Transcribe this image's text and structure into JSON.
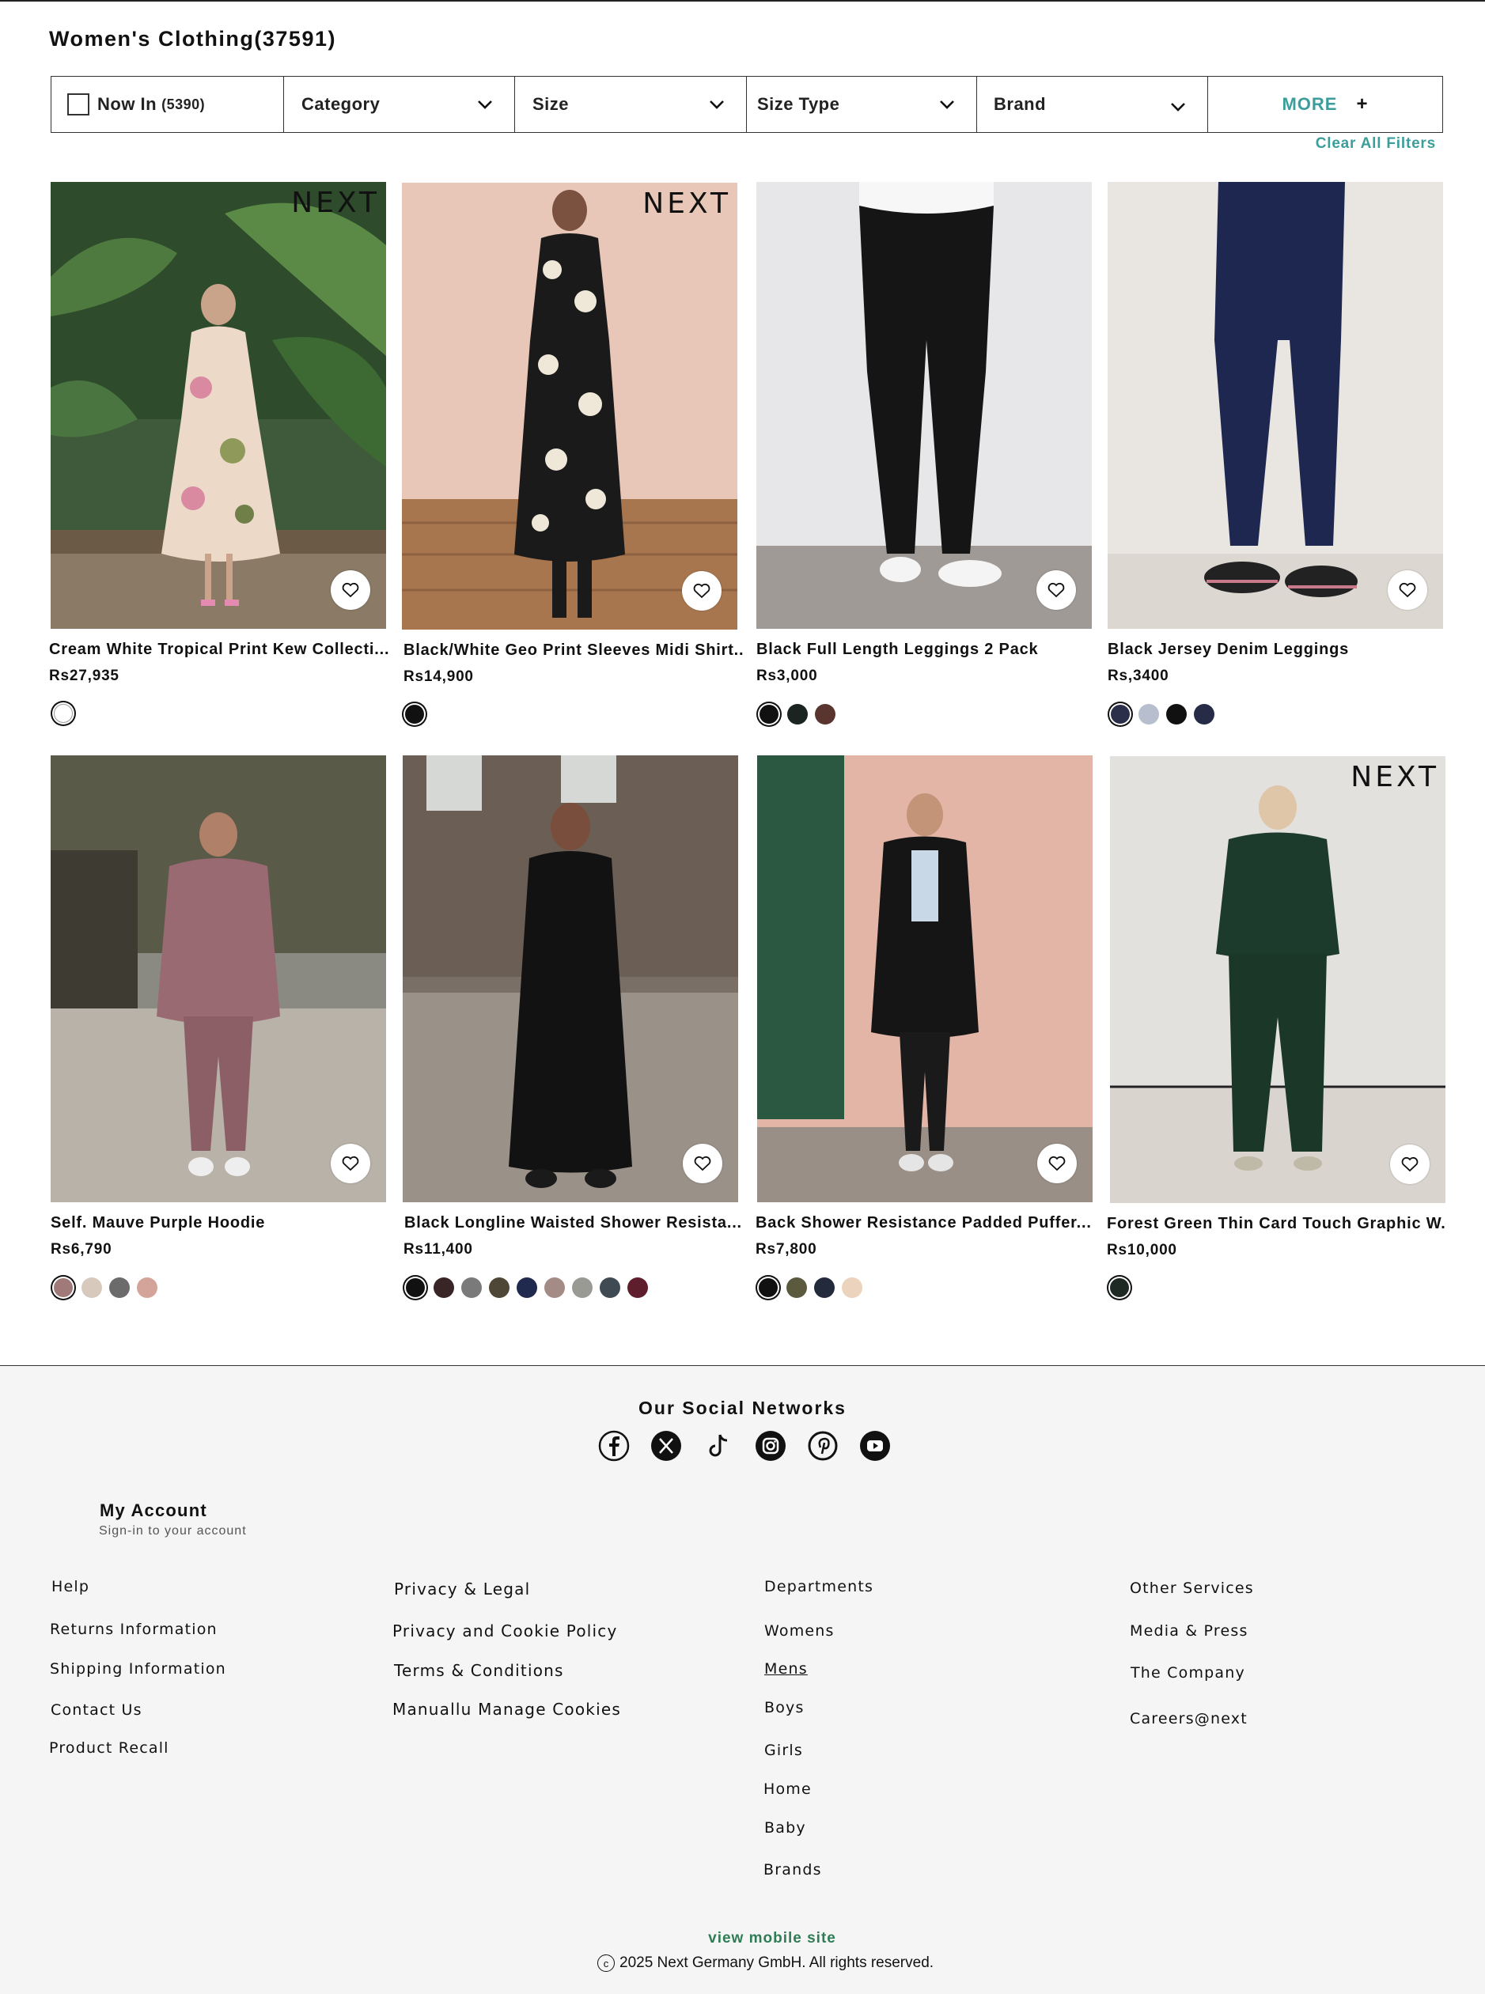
{
  "page": {
    "title": "Women's Clothing(37591)"
  },
  "filters": {
    "now_in_label": "Now In",
    "now_in_count": "(5390)",
    "category": "Category",
    "size": "Size",
    "size_type": "Size Type",
    "brand": "Brand",
    "more": "MORE",
    "more_icon": "+",
    "clear_all": "Clear All Filters"
  },
  "products": [
    {
      "name": "Cream White Tropical Print Kew Collecti...",
      "price": "Rs27,935",
      "brand_mark": "NEXT",
      "swatches": [
        "#ffffff"
      ]
    },
    {
      "name": "Black/White Geo Print Sleeves Midi Shirt..",
      "price": "Rs14,900",
      "brand_mark": "NEXT",
      "swatches": [
        "#111111"
      ]
    },
    {
      "name": "Black Full Length Leggings 2 Pack",
      "price": "Rs3,000",
      "brand_mark": "",
      "swatches": [
        "#111111",
        "#1b2420",
        "#5a3530"
      ]
    },
    {
      "name": "Black Jersey Denim Leggings",
      "price": "Rs,3400",
      "brand_mark": "",
      "swatches": [
        "#2b2f4a",
        "#b7bfcf",
        "#111111",
        "#262c48"
      ]
    },
    {
      "name": "Self. Mauve Purple Hoodie",
      "price": "Rs6,790",
      "brand_mark": "",
      "swatches": [
        "#a07a78",
        "#d8c9bd",
        "#6b6b6b",
        "#d4a49a"
      ]
    },
    {
      "name": "Black Longline Waisted Shower Resista...",
      "price": "Rs11,400",
      "brand_mark": "",
      "swatches": [
        "#111111",
        "#3a2526",
        "#7a7a7a",
        "#4e4636",
        "#1f2a4e",
        "#a58b86",
        "#9a9a95",
        "#404a52",
        "#5e1e2c"
      ]
    },
    {
      "name": "Back Shower Resistance Padded Puffer...",
      "price": "Rs7,800",
      "brand_mark": "",
      "swatches": [
        "#111111",
        "#5c5a3e",
        "#232a3c",
        "#ecd3bd"
      ]
    },
    {
      "name": "Forest Green Thin Card Touch Graphic W..",
      "price": "Rs10,000",
      "brand_mark": "NEXT",
      "swatches": [
        "#1f2a24"
      ]
    }
  ],
  "footer": {
    "social_title": "Our Social Networks",
    "social_icons": [
      "facebook-icon",
      "x-icon",
      "tiktok-icon",
      "instagram-icon",
      "pinterest-icon",
      "youtube-icon"
    ],
    "account_title": "My Account",
    "account_sub": "Sign-in to your account",
    "help": {
      "title": "Help",
      "links": [
        "Returns Information",
        "Shipping Information",
        "Contact Us",
        "Product Recall"
      ]
    },
    "privacy": {
      "title": "Privacy & Legal",
      "links": [
        "Privacy and Cookie Policy",
        "Terms & Conditions",
        "Manuallu Manage Cookies"
      ]
    },
    "departments": {
      "title": "Departments",
      "links": [
        "Womens",
        "Mens",
        "Boys",
        "Girls",
        "Home",
        "Baby",
        "Brands"
      ]
    },
    "services": {
      "title": "Other Services",
      "links": [
        "Media & Press",
        "The Company",
        "Careers@next"
      ]
    },
    "mobile_link": "view mobile site",
    "copyright": "2025 Next Germany GmbH. All rights reserved."
  },
  "colors": {
    "accent": "#3b9e9b",
    "mobile_link": "#2f7d55",
    "footer_bg": "#f5f5f5"
  }
}
